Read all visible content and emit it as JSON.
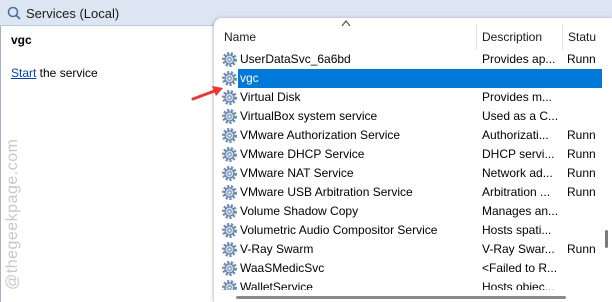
{
  "window": {
    "title": "Services (Local)"
  },
  "detail": {
    "service_name": "vgc",
    "start_link": "Start",
    "start_suffix": " the service"
  },
  "columns": {
    "name": "Name",
    "description": "Description",
    "status": "Statu"
  },
  "services": [
    {
      "name": "UserDataSvc_6a6bd",
      "description": "Provides ap...",
      "status": "Runn"
    },
    {
      "name": "vgc",
      "description": "",
      "status": "",
      "selected": true
    },
    {
      "name": "Virtual Disk",
      "description": "Provides m...",
      "status": ""
    },
    {
      "name": "VirtualBox system service",
      "description": "Used as a C...",
      "status": ""
    },
    {
      "name": "VMware Authorization Service",
      "description": "Authorizati...",
      "status": "Runn"
    },
    {
      "name": "VMware DHCP Service",
      "description": "DHCP servi...",
      "status": "Runn"
    },
    {
      "name": "VMware NAT Service",
      "description": "Network ad...",
      "status": "Runn"
    },
    {
      "name": "VMware USB Arbitration Service",
      "description": "Arbitration ...",
      "status": "Runn"
    },
    {
      "name": "Volume Shadow Copy",
      "description": "Manages an...",
      "status": ""
    },
    {
      "name": "Volumetric Audio Compositor Service",
      "description": "Hosts spati...",
      "status": ""
    },
    {
      "name": "V-Ray Swarm",
      "description": "V-Ray Swar...",
      "status": "Runn"
    },
    {
      "name": "WaaSMedicSvc",
      "description": "<Failed to R...",
      "status": ""
    },
    {
      "name": "WalletService",
      "description": "Hosts objec...",
      "status": ""
    }
  ],
  "watermark": "@thegeekpage.com",
  "colors": {
    "selection": "#0078d7",
    "titlebar": "#dce6f2",
    "arrow": "#e53935",
    "link": "#0645ad"
  },
  "icons": {
    "title": "services-icon",
    "row": "gear-icon",
    "pointer": "red-arrow-icon"
  }
}
